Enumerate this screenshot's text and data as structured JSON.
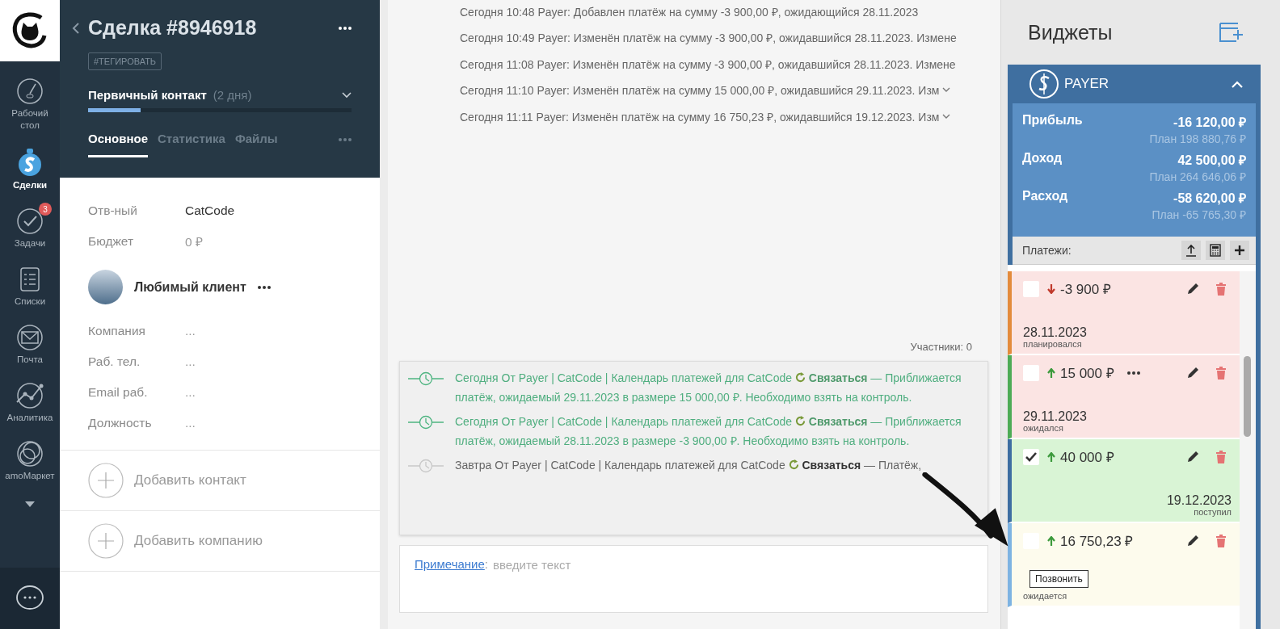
{
  "nav": {
    "items": [
      {
        "kind": "dashboard",
        "label": "Рабочий стол",
        "selected": false
      },
      {
        "kind": "deals",
        "label": "Сделки",
        "selected": true
      },
      {
        "kind": "tasks",
        "label": "Задачи",
        "selected": false,
        "badge": "3"
      },
      {
        "kind": "lists",
        "label": "Списки",
        "selected": false
      },
      {
        "kind": "mail",
        "label": "Почта",
        "selected": false
      },
      {
        "kind": "analytics",
        "label": "Аналитика",
        "selected": false
      },
      {
        "kind": "market",
        "label": "amoМаркет",
        "selected": false
      }
    ]
  },
  "deal": {
    "title": "Сделка #8946918",
    "tag_button": "#ТЕГИРОВАТЬ",
    "stage": "Первичный контакт",
    "stage_duration": "(2 дня)",
    "level": 0.2,
    "tabs": [
      {
        "label": "Основное",
        "selected": true
      },
      {
        "label": "Статистика",
        "selected": false
      },
      {
        "label": "Файлы",
        "selected": false
      }
    ],
    "fields": [
      {
        "label": "Отв-ный",
        "value": "CatCode",
        "kind": "value"
      },
      {
        "label": "Бюджет",
        "value": "0 ₽",
        "kind": "muted"
      }
    ],
    "contact": {
      "name": "Любимый клиент",
      "fields": [
        {
          "label": "Компания",
          "placeholder": "..."
        },
        {
          "label": "Раб. тел.",
          "placeholder": "..."
        },
        {
          "label": "Email раб.",
          "placeholder": "..."
        },
        {
          "label": "Должность",
          "placeholder": "..."
        }
      ]
    },
    "actions": [
      "Добавить контакт",
      "Добавить компанию"
    ]
  },
  "feed": {
    "log": [
      {
        "text": "Сегодня 10:48 Payer: Добавлен платёж на сумму -3 900,00 ₽, ожидающийся 28.11.2023",
        "expandable": false
      },
      {
        "text": "Сегодня 10:49 Payer: Изменён платёж на сумму -3 900,00 ₽, ожидавшийся 28.11.2023. Измене",
        "expandable": false
      },
      {
        "text": "Сегодня 11:08 Payer: Изменён платёж на сумму -3 900,00 ₽, ожидавшийся 28.11.2023. Измене",
        "expandable": false
      },
      {
        "text": "Сегодня 11:10 Payer: Изменён платёж на сумму 15 000,00 ₽, ожидавшийся 29.11.2023. Изм",
        "expandable": true
      },
      {
        "text": "Сегодня 11:11 Payer: Изменён платёж на сумму 16 750,23 ₽, ожидавшийся 19.12.2023. Изм",
        "expandable": true
      }
    ],
    "participants": "Участники: 0",
    "tasks": [
      {
        "when": "Сегодня",
        "source": "От Payer | CatCode | Календарь платежей для CatCode",
        "type": "Связаться",
        "text": "— Приближается платёж, ожидаемый 29.11.2023 в размере 15 000,00 ₽. Необходимо взять на контроль.",
        "kind": "current"
      },
      {
        "when": "Сегодня",
        "source": "От Payer | CatCode | Календарь платежей для CatCode",
        "type": "Связаться",
        "text": "— Приближается платёж, ожидаемый 28.11.2023 в размере -3 900,00 ₽. Необходимо взять на контроль.",
        "kind": "current"
      },
      {
        "when": "Завтра",
        "source": "От Payer | CatCode | Календарь платежей для CatCode",
        "type": "Связаться",
        "text": "— Платёж,",
        "kind": "future"
      }
    ],
    "note": {
      "link": "Примечание",
      "separator": ":",
      "placeholder": "введите текст"
    }
  },
  "widgets": {
    "title": "Виджеты",
    "payer": {
      "name": "PAYER",
      "expanded": true,
      "stats": [
        {
          "label": "Прибыль",
          "value": "-16 120,00 ₽",
          "plan": "План 198 880,76 ₽"
        },
        {
          "label": "Доход",
          "value": "42 500,00 ₽",
          "plan": "План 264 646,06 ₽"
        },
        {
          "label": "Расход",
          "value": "-58 620,00 ₽",
          "plan": "План -65 765,30 ₽"
        }
      ],
      "payments_label": "Платежи:",
      "payments": [
        {
          "amount": "-3 900 ₽",
          "incoming": false,
          "checked": false,
          "date": "28.11.2023",
          "status": "планировался",
          "color": "#e38b3b",
          "kind": "overdue",
          "more": false
        },
        {
          "amount": "15 000 ₽",
          "incoming": true,
          "checked": false,
          "date": "29.11.2023",
          "status": "ожидался",
          "color": "#4dab55",
          "kind": "overdue",
          "more": true
        },
        {
          "amount": "40 000 ₽",
          "incoming": true,
          "checked": true,
          "date": "19.12.2023",
          "status": "поступил",
          "color": "#3d6da1",
          "kind": "received",
          "more": false
        },
        {
          "amount": "16 750,23 ₽",
          "incoming": true,
          "checked": false,
          "status": "ожидается",
          "color": "#7db3e2",
          "kind": "pending",
          "more": false,
          "tooltip": "Позвонить"
        }
      ]
    }
  }
}
